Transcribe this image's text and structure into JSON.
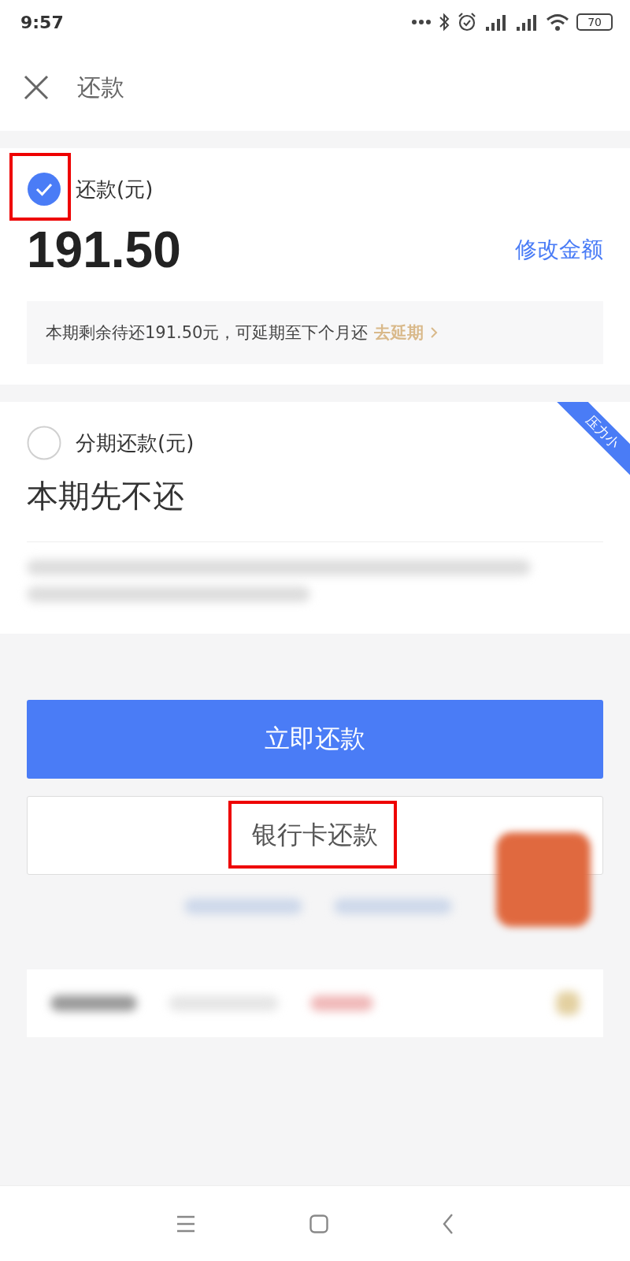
{
  "status_bar": {
    "time": "9:57",
    "battery": "70"
  },
  "header": {
    "title": "还款"
  },
  "options": [
    {
      "kind": "amount",
      "selected": true,
      "label": "还款(元)",
      "amount": "191.50",
      "action": "修改金额",
      "highlighted": true,
      "notice": "本期剩余待还191.50元，可延期至下个月还",
      "notice_link": "去延期"
    },
    {
      "kind": "installment",
      "selected": false,
      "label": "分期还款(元)",
      "amount": "本期先不还",
      "ribbon": "压力小"
    }
  ],
  "buttons": [
    {
      "kind": "primary",
      "label": "立即还款",
      "highlighted": false
    },
    {
      "kind": "secondary",
      "label": "银行卡还款",
      "highlighted": true
    }
  ]
}
